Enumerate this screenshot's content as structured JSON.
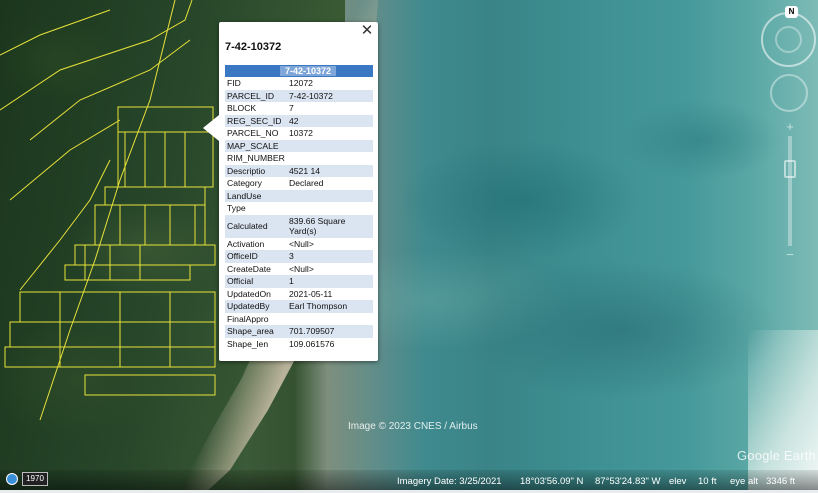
{
  "popup": {
    "title": "7-42-10372",
    "close_icon": "close-icon",
    "header": "7-42-10372",
    "attributes": [
      {
        "key": "FID",
        "value": "12072"
      },
      {
        "key": "PARCEL_ID",
        "value": "7-42-10372"
      },
      {
        "key": "BLOCK",
        "value": "7"
      },
      {
        "key": "REG_SEC_ID",
        "value": "42"
      },
      {
        "key": "PARCEL_NO",
        "value": "10372"
      },
      {
        "key": "MAP_SCALE",
        "value": ""
      },
      {
        "key": "RIM_NUMBER",
        "value": ""
      },
      {
        "key": "Descriptio",
        "value": "4521 14"
      },
      {
        "key": "Category",
        "value": "Declared"
      },
      {
        "key": "LandUse",
        "value": ""
      },
      {
        "key": "Type",
        "value": ""
      },
      {
        "key": "Calculated",
        "value": "839.66 Square Yard(s)"
      },
      {
        "key": "Activation",
        "value": "<Null>"
      },
      {
        "key": "OfficeID",
        "value": "3"
      },
      {
        "key": "CreateDate",
        "value": "<Null>"
      },
      {
        "key": "Official",
        "value": "1"
      },
      {
        "key": "UpdatedOn",
        "value": "2021-05-11"
      },
      {
        "key": "UpdatedBy",
        "value": "Earl Thompson"
      },
      {
        "key": "FinalAppro",
        "value": ""
      },
      {
        "key": "Shape_area",
        "value": "701.709507"
      },
      {
        "key": "Shape_len",
        "value": "109.061576"
      }
    ]
  },
  "navigation": {
    "north_label": "N",
    "compass_icon": "compass-ring-icon",
    "look_icon": "look-around-icon",
    "zoom_in_label": "+",
    "zoom_out_label": "−"
  },
  "map": {
    "credit": "Image © 2023 CNES / Airbus",
    "brand": "Google Earth",
    "parcel_color": "#e8e23a"
  },
  "status": {
    "historical_year": "1970",
    "imagery_date": "Imagery Date: 3/25/2021",
    "latitude": "18°03'56.09\" N",
    "longitude": "87°53'24.83\" W",
    "elev_label": "elev",
    "elev_value": "10 ft",
    "eye_alt_label": "eye alt",
    "eye_alt_value": "3346 ft"
  }
}
